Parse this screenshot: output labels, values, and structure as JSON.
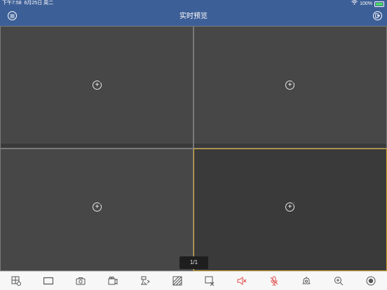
{
  "status_bar": {
    "time": "下午7:58",
    "date": "6月25日 周二",
    "battery": "100%"
  },
  "nav": {
    "title": "实时预览",
    "menu_icon": "menu-circle-icon",
    "exit_icon": "exit-door-icon"
  },
  "grid": {
    "panes": [
      {
        "name": "pane-1",
        "icon": "add-camera-icon",
        "selected": false
      },
      {
        "name": "pane-2",
        "icon": "add-camera-icon",
        "selected": false
      },
      {
        "name": "pane-3",
        "icon": "add-camera-icon",
        "selected": false
      },
      {
        "name": "pane-4",
        "icon": "add-camera-icon",
        "selected": true
      }
    ],
    "page_indicator": "1/1"
  },
  "toolbar": {
    "icons": [
      "window-split-settings-icon",
      "single-window-icon",
      "snapshot-camera-icon",
      "record-video-icon",
      "ptz-control-icon",
      "image-quality-icon",
      "stop-all-icon",
      "mute-audio-icon",
      "talk-microphone-icon",
      "alarm-output-icon",
      "digital-zoom-icon",
      "record-circle-icon"
    ],
    "accent_red": "#e24b4b"
  }
}
